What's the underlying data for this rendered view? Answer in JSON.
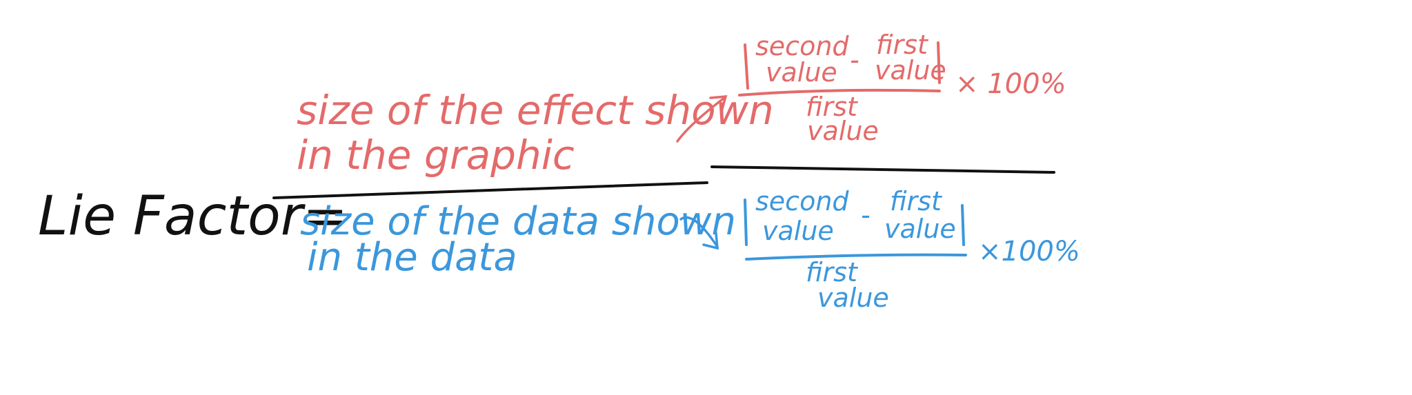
{
  "colors": {
    "graphic": "#e46a6a",
    "data": "#3b97dc",
    "ink": "#111111"
  },
  "formula": {
    "lhs": "Lie Factor=",
    "numerator": {
      "line1": "size of the effect shown",
      "line2": "in the graphic"
    },
    "denominator": {
      "line1": "size of the data shown",
      "line2": "in the data"
    }
  },
  "graphic_formula": {
    "term_a_line1": "second",
    "term_a_line2": "value",
    "minus": "-",
    "term_b_line1": "first",
    "term_b_line2": "value",
    "divisor_line1": "first",
    "divisor_line2": "value",
    "multiplier": "× 100%"
  },
  "data_formula": {
    "term_a_line1": "second",
    "term_a_line2": "value",
    "minus": "-",
    "term_b_line1": "first",
    "term_b_line2": "value",
    "divisor_line1": "first",
    "divisor_line2": "value",
    "multiplier": "×100%"
  }
}
